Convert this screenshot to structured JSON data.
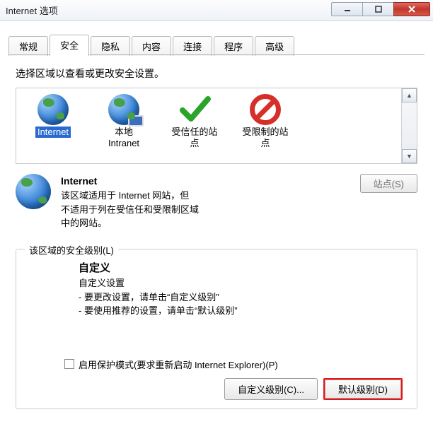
{
  "window": {
    "title": "Internet 选项"
  },
  "tabs": [
    "常规",
    "安全",
    "隐私",
    "内容",
    "连接",
    "程序",
    "高级"
  ],
  "active_tab_index": 1,
  "security": {
    "instruction": "选择区域以查看或更改安全设置。",
    "zones": [
      {
        "label": "Internet",
        "label2": ""
      },
      {
        "label": "本地",
        "label2": "Intranet"
      },
      {
        "label": "受信任的站",
        "label2": "点"
      },
      {
        "label": "受限制的站",
        "label2": "点"
      }
    ],
    "zone_title": "Internet",
    "zone_desc_l1": "该区域适用于 Internet 网站，但",
    "zone_desc_l2": "不适用于列在受信任和受限制区域",
    "zone_desc_l3": "中的网站。",
    "sites_button": "站点(S)",
    "level_legend": "该区域的安全级别(L)",
    "custom_title": "自定义",
    "custom_sub": "自定义设置",
    "custom_h1": "- 要更改设置，请单击“自定义级别”",
    "custom_h2": "- 要使用推荐的设置，请单击“默认级别”",
    "protect_label": "启用保护模式(要求重新启动 Internet Explorer)(P)",
    "custom_level_btn": "自定义级别(C)...",
    "default_level_btn": "默认级别(D)"
  }
}
